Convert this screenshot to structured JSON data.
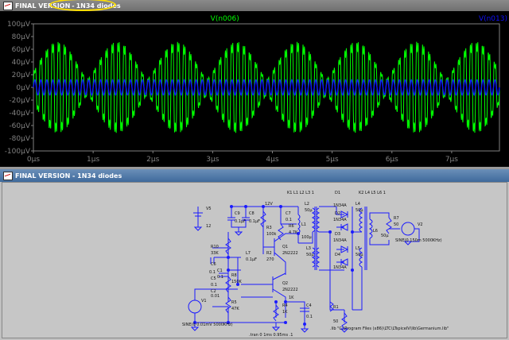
{
  "plot_window": {
    "title_left": "FINAL VERSION",
    "title_sep": "-",
    "title_right": "1N34 diodes"
  },
  "schematic_window": {
    "title": "FINAL VERSION - 1N34 diodes"
  },
  "chart_data": {
    "type": "line",
    "x_tick_labels": [
      "0µs",
      "1µs",
      "2µs",
      "3µs",
      "4µs",
      "5µs",
      "6µs",
      "7µs"
    ],
    "y_tick_labels": [
      "100µV",
      "80µV",
      "60µV",
      "40µV",
      "20µV",
      "0µV",
      "-20µV",
      "-40µV",
      "-60µV",
      "-80µV",
      "-100µV"
    ],
    "xlim": [
      0,
      7.8
    ],
    "ylim": [
      -100,
      100
    ],
    "x_unit": "µs",
    "y_unit": "µV",
    "grid": false,
    "series": [
      {
        "name": "V(n006)",
        "color": "#00ff00",
        "carrier_MHz": 10.0,
        "envelope_MHz": 2.0,
        "peak_uV": 92,
        "mean_uV": 0
      },
      {
        "name": "V(n013)",
        "color": "#0000ff",
        "carrier_MHz": 10.0,
        "amplitude_uV": 12
      }
    ]
  },
  "schematic": {
    "labels": [
      {
        "id": "v5",
        "text": "V5"
      },
      {
        "id": "v5val",
        "text": "12"
      },
      {
        "id": "c9",
        "text": "C9"
      },
      {
        "id": "c9val",
        "text": "0.1µF"
      },
      {
        "id": "c8",
        "text": "C8"
      },
      {
        "id": "c8val",
        "text": "0.1µF"
      },
      {
        "id": "supply",
        "text": "12V"
      },
      {
        "id": "r3",
        "text": "R3"
      },
      {
        "id": "r3val",
        "text": "100k"
      },
      {
        "id": "c7",
        "text": "C7"
      },
      {
        "id": "c7val",
        "text": "0.1"
      },
      {
        "id": "r6",
        "text": "R6"
      },
      {
        "id": "r6val",
        "text": "4.7K"
      },
      {
        "id": "l1",
        "text": "L1"
      },
      {
        "id": "l1val",
        "text": "100µ"
      },
      {
        "id": "k1",
        "text": "K1 L1 L2 L3 1"
      },
      {
        "id": "k2",
        "text": "K2 L4 L5 L6 1"
      },
      {
        "id": "l2",
        "text": "L2"
      },
      {
        "id": "l2val",
        "text": "50µ"
      },
      {
        "id": "l3",
        "text": "L3"
      },
      {
        "id": "l3val",
        "text": "50µ"
      },
      {
        "id": "l4",
        "text": "L4"
      },
      {
        "id": "l4val",
        "text": "50µ"
      },
      {
        "id": "l5",
        "text": "L5"
      },
      {
        "id": "l5val",
        "text": "50µ"
      },
      {
        "id": "l6",
        "text": "L6"
      },
      {
        "id": "l6val",
        "text": "50µ"
      },
      {
        "id": "d1",
        "text": "D1"
      },
      {
        "id": "d1val",
        "text": "1N34A"
      },
      {
        "id": "d2",
        "text": "D2"
      },
      {
        "id": "d2val",
        "text": "1N34A"
      },
      {
        "id": "d3",
        "text": "D3"
      },
      {
        "id": "d3val",
        "text": "1N34A"
      },
      {
        "id": "d4",
        "text": "D4"
      },
      {
        "id": "d4val",
        "text": "1N34A"
      },
      {
        "id": "r7",
        "text": "R7"
      },
      {
        "id": "r7val",
        "text": "50"
      },
      {
        "id": "v2",
        "text": "V2"
      },
      {
        "id": "v2val",
        "text": "SINE(0 150m 5000KHz)"
      },
      {
        "id": "r10",
        "text": "R10"
      },
      {
        "id": "r10val",
        "text": "33K"
      },
      {
        "id": "l7",
        "text": "L7"
      },
      {
        "id": "l7val",
        "text": "0.1µF"
      },
      {
        "id": "r2",
        "text": "R2"
      },
      {
        "id": "r2val",
        "text": "270"
      },
      {
        "id": "q1",
        "text": "Q1"
      },
      {
        "id": "q1val",
        "text": "2N2222"
      },
      {
        "id": "c6",
        "text": "C6"
      },
      {
        "id": "c6val",
        "text": "0.1"
      },
      {
        "id": "c1",
        "text": "C1"
      },
      {
        "id": "c1val",
        "text": "0.1"
      },
      {
        "id": "r8",
        "text": "R8"
      },
      {
        "id": "r8val",
        "text": "150K"
      },
      {
        "id": "c5",
        "text": "C5"
      },
      {
        "id": "c5val",
        "text": "0.1"
      },
      {
        "id": "c2",
        "text": "C2"
      },
      {
        "id": "c2val",
        "text": "0.01"
      },
      {
        "id": "q2",
        "text": "Q2"
      },
      {
        "id": "q2val",
        "text": "2N2222"
      },
      {
        "id": "v1",
        "text": "V1"
      },
      {
        "id": "r5",
        "text": "R5"
      },
      {
        "id": "r5val",
        "text": "47K"
      },
      {
        "id": "r4",
        "text": "R4"
      },
      {
        "id": "r4val",
        "text": "1K"
      },
      {
        "id": "c4",
        "text": "C4"
      },
      {
        "id": "c4val",
        "text": "0.1"
      },
      {
        "id": "v1val",
        "text": "SINE(0 0.01mV 5000KHz)"
      },
      {
        "id": "r1",
        "text": "R1"
      },
      {
        "id": "r1val",
        "text": "50"
      },
      {
        "id": "rval2",
        "text": "1K"
      },
      {
        "id": "tran",
        "text": ".tran 0 1ms 0.95ms .1"
      },
      {
        "id": "lib",
        "text": ".lib \"C:\\Program Files (x86)\\LTC\\LTspiceIV\\lib\\Germanium.lib\""
      }
    ]
  }
}
